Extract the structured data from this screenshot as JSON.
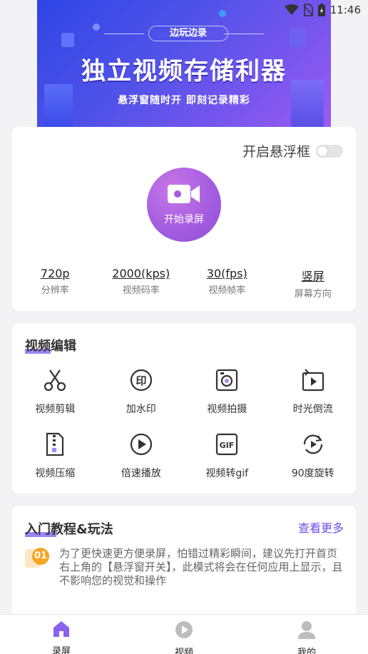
{
  "status_bar": {
    "time": "11:46",
    "icons": [
      "wifi-icon",
      "no-sim-icon",
      "battery-charging-icon"
    ]
  },
  "banner": {
    "pill": "边玩边录",
    "title": "独立视频存储利器",
    "subtitle": "悬浮窗随时开 即刻记录精彩"
  },
  "recorder": {
    "float_label": "开启悬浮框",
    "float_enabled": false,
    "record_label": "开始录屏",
    "stats": [
      {
        "value": "720p",
        "label": "分辨率"
      },
      {
        "value": "2000(kps)",
        "label": "视频码率"
      },
      {
        "value": "30(fps)",
        "label": "视频帧率"
      },
      {
        "value": "竖屏",
        "label": "屏幕方向"
      }
    ]
  },
  "video_edit": {
    "title": "视频编辑",
    "tools": [
      {
        "label": "视频剪辑",
        "icon": "scissors-icon"
      },
      {
        "label": "加水印",
        "icon": "stamp-icon"
      },
      {
        "label": "视频拍摄",
        "icon": "camera-icon"
      },
      {
        "label": "时光倒流",
        "icon": "rewind-icon"
      },
      {
        "label": "视频压缩",
        "icon": "zip-file-icon"
      },
      {
        "label": "倍速播放",
        "icon": "play-circle-icon"
      },
      {
        "label": "视频转gif",
        "icon": "gif-icon"
      },
      {
        "label": "90度旋转",
        "icon": "rotate-icon"
      }
    ]
  },
  "tutorial": {
    "title": "入门教程&玩法",
    "more": "查看更多",
    "items": [
      {
        "num": "01",
        "text": "为了更快速更方便录屏，怕错过精彩瞬间，建议先打开首页右上角的【悬浮窗开关】，此模式将会在任何应用上显示，且不影响您的视觉和操作"
      }
    ]
  },
  "tabs": [
    {
      "label": "录屏",
      "icon": "home-icon",
      "active": true
    },
    {
      "label": "视频",
      "icon": "play-icon",
      "active": false
    },
    {
      "label": "我的",
      "icon": "user-icon",
      "active": false
    }
  ],
  "colors": {
    "accent": "#7b5cf0",
    "badge": "#f6a623"
  }
}
